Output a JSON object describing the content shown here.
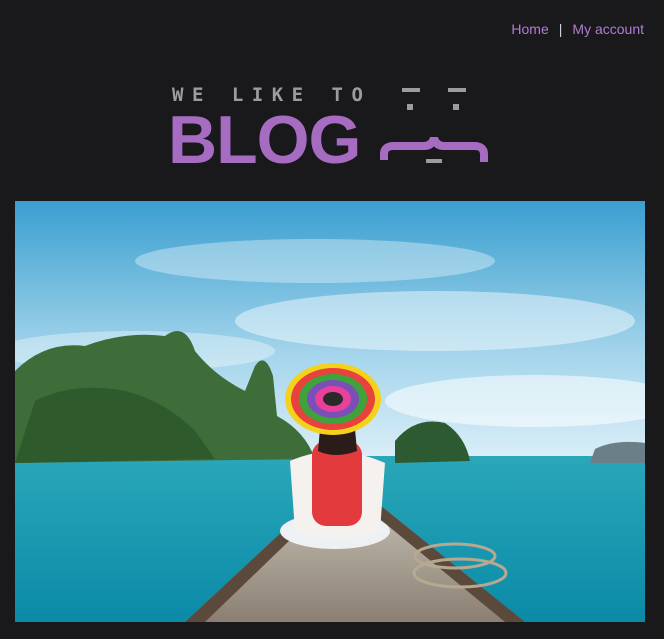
{
  "nav": {
    "home_label": "Home",
    "separator": "|",
    "account_label": "My account"
  },
  "logo": {
    "tagline": "WE LIKE TO",
    "word": "BLOG"
  },
  "colors": {
    "background": "#19191b",
    "link": "#b07cd2",
    "brand": "#a66cc2",
    "tagline": "#9b9ba1"
  },
  "hero": {
    "description_icon": "woman-in-rainbow-hat-on-boat-photo"
  }
}
